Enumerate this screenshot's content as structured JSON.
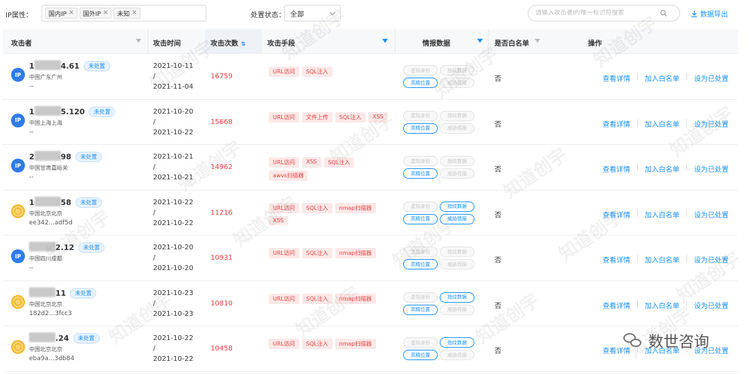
{
  "filters": {
    "ip_attr_label": "IP属性：",
    "ip_tags": [
      "国内IP",
      "国外IP",
      "未知"
    ],
    "status_label": "处置状态：",
    "status_value": "全部",
    "search_placeholder": "请输入攻击者IP/唯一标识符搜索",
    "export_label": "数据导出"
  },
  "columns": {
    "attacker": "攻击者",
    "time": "攻击时间",
    "count": "攻击次数",
    "method": "攻击手段",
    "intel": "情报数据",
    "whitelist": "是否白名单",
    "ops": "操作"
  },
  "intel_labels": [
    "虚拟身份",
    "指纹数据",
    "高精位置",
    "威胁情报"
  ],
  "ops_labels": [
    "查看详情",
    "加入白名单",
    "设为已处置"
  ],
  "rows": [
    {
      "ip_prefix": "1",
      "ip_suffix": "4.61",
      "status": "未处置",
      "avatar": "IP",
      "avatar_type": "ip",
      "location": "中国广东广州",
      "hash": "--",
      "time_start": "2021-10-11",
      "time_sep": "/",
      "time_end": "2021-11-04",
      "count": "16759",
      "methods": [
        "URL访问",
        "SQL注入"
      ],
      "intel": [
        false,
        false,
        true,
        false
      ],
      "whitelist": "否"
    },
    {
      "ip_prefix": "1",
      "ip_suffix": "5.120",
      "status": "未处置",
      "avatar": "IP",
      "avatar_type": "ip",
      "location": "中国上海上海",
      "hash": "--",
      "time_start": "2021-10-20",
      "time_sep": "/",
      "time_end": "2021-10-22",
      "count": "15668",
      "methods": [
        "URL访问",
        "文件上传",
        "SQL注入",
        "XSS"
      ],
      "intel": [
        false,
        false,
        true,
        false
      ],
      "whitelist": "否"
    },
    {
      "ip_prefix": "2",
      "ip_suffix": "98",
      "status": "未处置",
      "avatar": "IP",
      "avatar_type": "ip",
      "location": "中国甘肃嘉峪关",
      "hash": "--",
      "time_start": "2021-10-21",
      "time_sep": "/",
      "time_end": "2021-10-21",
      "count": "14962",
      "methods": [
        "URL访问",
        "XSS",
        "SQL注入",
        "awvs扫描器"
      ],
      "intel": [
        false,
        false,
        true,
        false
      ],
      "whitelist": "否"
    },
    {
      "ip_prefix": "1",
      "ip_suffix": "58",
      "status": "未处置",
      "avatar": "",
      "avatar_type": "coin",
      "location": "中国北京北京",
      "hash": "ee342...adf5d",
      "time_start": "2021-10-22",
      "time_sep": "/",
      "time_end": "2021-10-22",
      "count": "11216",
      "methods": [
        "URL访问",
        "SQL注入",
        "nmap扫描器",
        "XSS"
      ],
      "intel": [
        false,
        true,
        true,
        true
      ],
      "whitelist": "否"
    },
    {
      "ip_prefix": "",
      "ip_suffix": "2.12",
      "status": "未处置",
      "avatar": "IP",
      "avatar_type": "ip",
      "location": "中国四川成都",
      "hash": "--",
      "time_start": "2021-10-20",
      "time_sep": "/",
      "time_end": "2021-10-20",
      "count": "10931",
      "methods": [
        "URL访问",
        "SQL注入",
        "nmap扫描器"
      ],
      "intel": [
        false,
        false,
        true,
        false
      ],
      "whitelist": "否"
    },
    {
      "ip_prefix": "",
      "ip_suffix": "11",
      "status": "未处置",
      "avatar": "",
      "avatar_type": "coin",
      "location": "中国北京北京",
      "hash": "182d2...3fcc3",
      "time_start": "2021-10-23",
      "time_sep": "/",
      "time_end": "2021-10-23",
      "count": "10810",
      "methods": [
        "URL访问",
        "SQL注入",
        "nmap扫描器"
      ],
      "intel": [
        false,
        true,
        true,
        false
      ],
      "whitelist": "否"
    },
    {
      "ip_prefix": "",
      "ip_suffix": ".24",
      "status": "未处置",
      "avatar": "",
      "avatar_type": "coin",
      "location": "中国北京北京",
      "hash": "eba9a...3db84",
      "time_start": "2021-10-22",
      "time_sep": "/",
      "time_end": "2021-10-22",
      "count": "10458",
      "methods": [
        "URL访问",
        "SQL注入",
        "nmap扫描器"
      ],
      "intel": [
        false,
        true,
        true,
        false
      ],
      "whitelist": "否"
    }
  ],
  "watermark": "知道创宇",
  "brand": "数世咨询"
}
